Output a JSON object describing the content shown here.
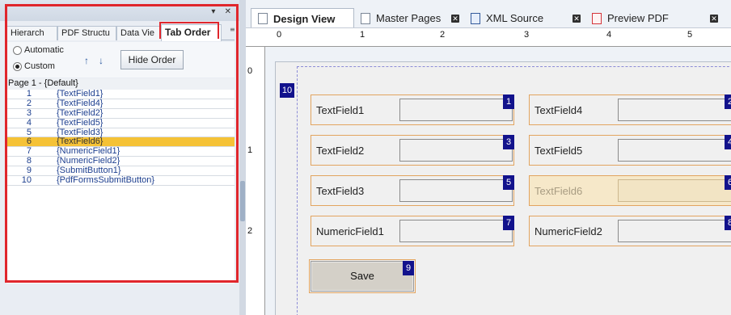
{
  "panel": {
    "tabs": [
      "Hierarch",
      "PDF Structu",
      "Data Vie",
      "Tab Order"
    ],
    "options": {
      "automatic": "Automatic",
      "custom": "Custom",
      "hide_order": "Hide Order"
    },
    "tree_header": "Page 1 - {Default}",
    "tree_items": [
      {
        "num": "1",
        "label": "{TextField1}"
      },
      {
        "num": "2",
        "label": "{TextField4}"
      },
      {
        "num": "3",
        "label": "{TextField2}"
      },
      {
        "num": "4",
        "label": "{TextField5}"
      },
      {
        "num": "5",
        "label": "{TextField3}"
      },
      {
        "num": "6",
        "label": "{TextField6}"
      },
      {
        "num": "7",
        "label": "{NumericField1}"
      },
      {
        "num": "8",
        "label": "{NumericField2}"
      },
      {
        "num": "9",
        "label": "{SubmitButton1}"
      },
      {
        "num": "10",
        "label": "{PdfFormsSubmitButton}"
      }
    ],
    "selected_index": 5
  },
  "doc_tabs": [
    "Design View",
    "Master Pages",
    "XML Source",
    "Preview PDF"
  ],
  "ruler": {
    "h": [
      "0",
      "1",
      "2",
      "3",
      "4",
      "5"
    ],
    "v": [
      "0",
      "1",
      "2"
    ]
  },
  "form": {
    "page_badge": "10",
    "fields": [
      {
        "label": "TextField1",
        "badge": "1"
      },
      {
        "label": "TextField4",
        "badge": "2"
      },
      {
        "label": "TextField2",
        "badge": "3"
      },
      {
        "label": "TextField5",
        "badge": "4"
      },
      {
        "label": "TextField3",
        "badge": "5"
      },
      {
        "label": "TextField6",
        "badge": "6"
      },
      {
        "label": "NumericField1",
        "badge": "7"
      },
      {
        "label": "NumericField2",
        "badge": "8"
      }
    ],
    "save_label": "Save",
    "save_badge": "9"
  },
  "icons": {
    "up": "arrow-up-icon",
    "down": "arrow-down-icon",
    "close": "close-icon",
    "pdf": "pdf-icon",
    "xml": "xml-icon",
    "page": "page-icon"
  },
  "colors": {
    "highlight": "#e0262c",
    "selected_row": "#f5c236",
    "badge": "#12128c",
    "field_border": "#e2a45f"
  }
}
